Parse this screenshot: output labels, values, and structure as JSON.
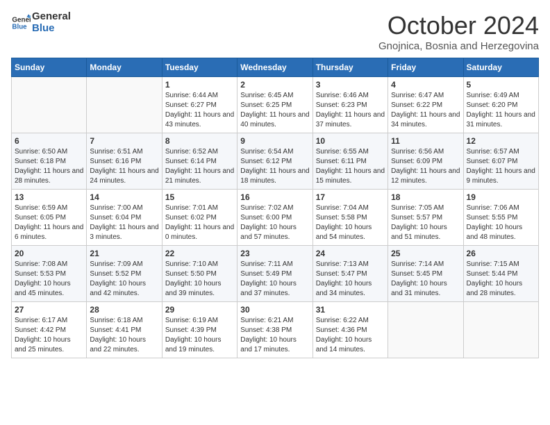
{
  "header": {
    "logo_line1": "General",
    "logo_line2": "Blue",
    "month_title": "October 2024",
    "subtitle": "Gnojnica, Bosnia and Herzegovina"
  },
  "weekdays": [
    "Sunday",
    "Monday",
    "Tuesday",
    "Wednesday",
    "Thursday",
    "Friday",
    "Saturday"
  ],
  "weeks": [
    [
      {
        "day": "",
        "sunrise": "",
        "sunset": "",
        "daylight": ""
      },
      {
        "day": "",
        "sunrise": "",
        "sunset": "",
        "daylight": ""
      },
      {
        "day": "1",
        "sunrise": "Sunrise: 6:44 AM",
        "sunset": "Sunset: 6:27 PM",
        "daylight": "Daylight: 11 hours and 43 minutes."
      },
      {
        "day": "2",
        "sunrise": "Sunrise: 6:45 AM",
        "sunset": "Sunset: 6:25 PM",
        "daylight": "Daylight: 11 hours and 40 minutes."
      },
      {
        "day": "3",
        "sunrise": "Sunrise: 6:46 AM",
        "sunset": "Sunset: 6:23 PM",
        "daylight": "Daylight: 11 hours and 37 minutes."
      },
      {
        "day": "4",
        "sunrise": "Sunrise: 6:47 AM",
        "sunset": "Sunset: 6:22 PM",
        "daylight": "Daylight: 11 hours and 34 minutes."
      },
      {
        "day": "5",
        "sunrise": "Sunrise: 6:49 AM",
        "sunset": "Sunset: 6:20 PM",
        "daylight": "Daylight: 11 hours and 31 minutes."
      }
    ],
    [
      {
        "day": "6",
        "sunrise": "Sunrise: 6:50 AM",
        "sunset": "Sunset: 6:18 PM",
        "daylight": "Daylight: 11 hours and 28 minutes."
      },
      {
        "day": "7",
        "sunrise": "Sunrise: 6:51 AM",
        "sunset": "Sunset: 6:16 PM",
        "daylight": "Daylight: 11 hours and 24 minutes."
      },
      {
        "day": "8",
        "sunrise": "Sunrise: 6:52 AM",
        "sunset": "Sunset: 6:14 PM",
        "daylight": "Daylight: 11 hours and 21 minutes."
      },
      {
        "day": "9",
        "sunrise": "Sunrise: 6:54 AM",
        "sunset": "Sunset: 6:12 PM",
        "daylight": "Daylight: 11 hours and 18 minutes."
      },
      {
        "day": "10",
        "sunrise": "Sunrise: 6:55 AM",
        "sunset": "Sunset: 6:11 PM",
        "daylight": "Daylight: 11 hours and 15 minutes."
      },
      {
        "day": "11",
        "sunrise": "Sunrise: 6:56 AM",
        "sunset": "Sunset: 6:09 PM",
        "daylight": "Daylight: 11 hours and 12 minutes."
      },
      {
        "day": "12",
        "sunrise": "Sunrise: 6:57 AM",
        "sunset": "Sunset: 6:07 PM",
        "daylight": "Daylight: 11 hours and 9 minutes."
      }
    ],
    [
      {
        "day": "13",
        "sunrise": "Sunrise: 6:59 AM",
        "sunset": "Sunset: 6:05 PM",
        "daylight": "Daylight: 11 hours and 6 minutes."
      },
      {
        "day": "14",
        "sunrise": "Sunrise: 7:00 AM",
        "sunset": "Sunset: 6:04 PM",
        "daylight": "Daylight: 11 hours and 3 minutes."
      },
      {
        "day": "15",
        "sunrise": "Sunrise: 7:01 AM",
        "sunset": "Sunset: 6:02 PM",
        "daylight": "Daylight: 11 hours and 0 minutes."
      },
      {
        "day": "16",
        "sunrise": "Sunrise: 7:02 AM",
        "sunset": "Sunset: 6:00 PM",
        "daylight": "Daylight: 10 hours and 57 minutes."
      },
      {
        "day": "17",
        "sunrise": "Sunrise: 7:04 AM",
        "sunset": "Sunset: 5:58 PM",
        "daylight": "Daylight: 10 hours and 54 minutes."
      },
      {
        "day": "18",
        "sunrise": "Sunrise: 7:05 AM",
        "sunset": "Sunset: 5:57 PM",
        "daylight": "Daylight: 10 hours and 51 minutes."
      },
      {
        "day": "19",
        "sunrise": "Sunrise: 7:06 AM",
        "sunset": "Sunset: 5:55 PM",
        "daylight": "Daylight: 10 hours and 48 minutes."
      }
    ],
    [
      {
        "day": "20",
        "sunrise": "Sunrise: 7:08 AM",
        "sunset": "Sunset: 5:53 PM",
        "daylight": "Daylight: 10 hours and 45 minutes."
      },
      {
        "day": "21",
        "sunrise": "Sunrise: 7:09 AM",
        "sunset": "Sunset: 5:52 PM",
        "daylight": "Daylight: 10 hours and 42 minutes."
      },
      {
        "day": "22",
        "sunrise": "Sunrise: 7:10 AM",
        "sunset": "Sunset: 5:50 PM",
        "daylight": "Daylight: 10 hours and 39 minutes."
      },
      {
        "day": "23",
        "sunrise": "Sunrise: 7:11 AM",
        "sunset": "Sunset: 5:49 PM",
        "daylight": "Daylight: 10 hours and 37 minutes."
      },
      {
        "day": "24",
        "sunrise": "Sunrise: 7:13 AM",
        "sunset": "Sunset: 5:47 PM",
        "daylight": "Daylight: 10 hours and 34 minutes."
      },
      {
        "day": "25",
        "sunrise": "Sunrise: 7:14 AM",
        "sunset": "Sunset: 5:45 PM",
        "daylight": "Daylight: 10 hours and 31 minutes."
      },
      {
        "day": "26",
        "sunrise": "Sunrise: 7:15 AM",
        "sunset": "Sunset: 5:44 PM",
        "daylight": "Daylight: 10 hours and 28 minutes."
      }
    ],
    [
      {
        "day": "27",
        "sunrise": "Sunrise: 6:17 AM",
        "sunset": "Sunset: 4:42 PM",
        "daylight": "Daylight: 10 hours and 25 minutes."
      },
      {
        "day": "28",
        "sunrise": "Sunrise: 6:18 AM",
        "sunset": "Sunset: 4:41 PM",
        "daylight": "Daylight: 10 hours and 22 minutes."
      },
      {
        "day": "29",
        "sunrise": "Sunrise: 6:19 AM",
        "sunset": "Sunset: 4:39 PM",
        "daylight": "Daylight: 10 hours and 19 minutes."
      },
      {
        "day": "30",
        "sunrise": "Sunrise: 6:21 AM",
        "sunset": "Sunset: 4:38 PM",
        "daylight": "Daylight: 10 hours and 17 minutes."
      },
      {
        "day": "31",
        "sunrise": "Sunrise: 6:22 AM",
        "sunset": "Sunset: 4:36 PM",
        "daylight": "Daylight: 10 hours and 14 minutes."
      },
      {
        "day": "",
        "sunrise": "",
        "sunset": "",
        "daylight": ""
      },
      {
        "day": "",
        "sunrise": "",
        "sunset": "",
        "daylight": ""
      }
    ]
  ]
}
